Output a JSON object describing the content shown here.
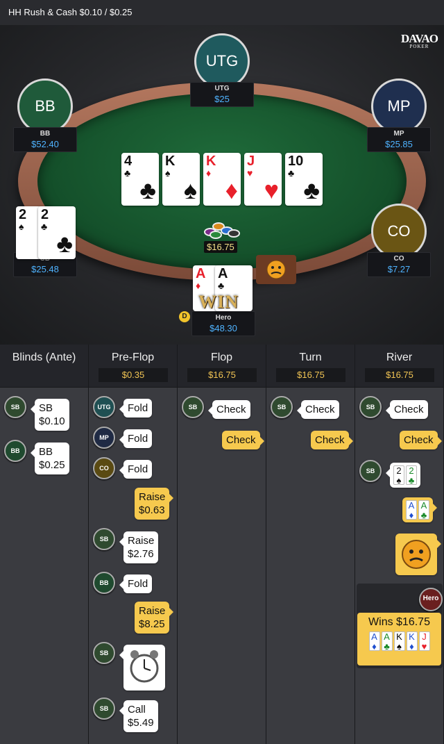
{
  "title": "HH  Rush & Cash $0.10 / $0.25",
  "logo": {
    "main": "DAVAO",
    "sub": "POKER"
  },
  "seats": [
    {
      "id": "utg",
      "avatar": "UTG",
      "name": "UTG",
      "stack": "$25",
      "color": "#1f5a5e"
    },
    {
      "id": "bb",
      "avatar": "BB",
      "name": "BB",
      "stack": "$52.40",
      "color": "#1f5a3a"
    },
    {
      "id": "mp",
      "avatar": "MP",
      "name": "MP",
      "stack": "$25.85",
      "color": "#1f2f4f"
    },
    {
      "id": "sb",
      "avatar": "",
      "name": "SB",
      "stack": "$25.48",
      "color": "#2a3a2a"
    },
    {
      "id": "co",
      "avatar": "CO",
      "name": "CO",
      "stack": "$7.27",
      "color": "#6a5514"
    },
    {
      "id": "hero",
      "avatar": "",
      "name": "Hero",
      "stack": "$48.30",
      "color": "#444"
    }
  ],
  "board": [
    {
      "rank": "4",
      "suit": "♣",
      "color": "black"
    },
    {
      "rank": "K",
      "suit": "♠",
      "color": "black"
    },
    {
      "rank": "K",
      "suit": "♦",
      "color": "red"
    },
    {
      "rank": "J",
      "suit": "♥",
      "color": "red"
    },
    {
      "rank": "10",
      "suit": "♣",
      "color": "black"
    }
  ],
  "sb_cards": [
    {
      "rank": "2",
      "suit": "♠",
      "color": "black"
    },
    {
      "rank": "2",
      "suit": "♣",
      "color": "black"
    }
  ],
  "hero_cards": [
    {
      "rank": "A",
      "suit": "♦",
      "color": "red"
    },
    {
      "rank": "A",
      "suit": "♣",
      "color": "black"
    }
  ],
  "pot": "$16.75",
  "dealer_label": "D",
  "win_text": "WIN",
  "columns": [
    {
      "title": "Blinds (Ante)",
      "pot": ""
    },
    {
      "title": "Pre-Flop",
      "pot": "$0.35"
    },
    {
      "title": "Flop",
      "pot": "$16.75"
    },
    {
      "title": "Turn",
      "pot": "$16.75"
    },
    {
      "title": "River",
      "pot": "$16.75"
    }
  ],
  "actions": {
    "blinds": [
      {
        "who": "SB",
        "line1": "SB",
        "line2": "$0.10"
      },
      {
        "who": "BB",
        "line1": "BB",
        "line2": "$0.25"
      }
    ],
    "preflop": [
      {
        "who": "UTG",
        "text": "Fold"
      },
      {
        "who": "MP",
        "text": "Fold"
      },
      {
        "who": "CO",
        "text": "Fold"
      },
      {
        "who": "Hero",
        "line1": "Raise",
        "line2": "$0.63"
      },
      {
        "who": "SB",
        "line1": "Raise",
        "line2": "$2.76"
      },
      {
        "who": "BB",
        "text": "Fold"
      },
      {
        "who": "Hero",
        "line1": "Raise",
        "line2": "$8.25"
      },
      {
        "who": "SB",
        "text": "timer"
      },
      {
        "who": "SB",
        "line1": "Call",
        "line2": "$5.49"
      }
    ],
    "flop": [
      {
        "who": "SB",
        "text": "Check"
      },
      {
        "who": "Hero",
        "text": "Check"
      }
    ],
    "turn": [
      {
        "who": "SB",
        "text": "Check"
      },
      {
        "who": "Hero",
        "text": "Check"
      }
    ],
    "river": [
      {
        "who": "SB",
        "text": "Check"
      },
      {
        "who": "Hero",
        "text": "Check"
      }
    ]
  },
  "showdown": {
    "sb_show": [
      {
        "rank": "2",
        "suit": "♠",
        "color": "black"
      },
      {
        "rank": "2",
        "suit": "♣",
        "color": "green"
      }
    ],
    "hero_show": [
      {
        "rank": "A",
        "suit": "♦",
        "color": "blue"
      },
      {
        "rank": "A",
        "suit": "♣",
        "color": "green"
      }
    ],
    "winner_badge": "Hero",
    "wins_text": "Wins $16.75",
    "best_hand": [
      {
        "rank": "A",
        "suit": "♦",
        "color": "blue"
      },
      {
        "rank": "A",
        "suit": "♣",
        "color": "green"
      },
      {
        "rank": "K",
        "suit": "♠",
        "color": "black"
      },
      {
        "rank": "K",
        "suit": "♦",
        "color": "blue"
      },
      {
        "rank": "J",
        "suit": "♥",
        "color": "red"
      }
    ]
  },
  "icon_colors": {
    "SB": "#2f4a2f",
    "BB": "#1f4a2f",
    "UTG": "#1f4f52",
    "MP": "#1f2a44",
    "CO": "#5a4a12",
    "Hero": "#6a1f1f"
  }
}
